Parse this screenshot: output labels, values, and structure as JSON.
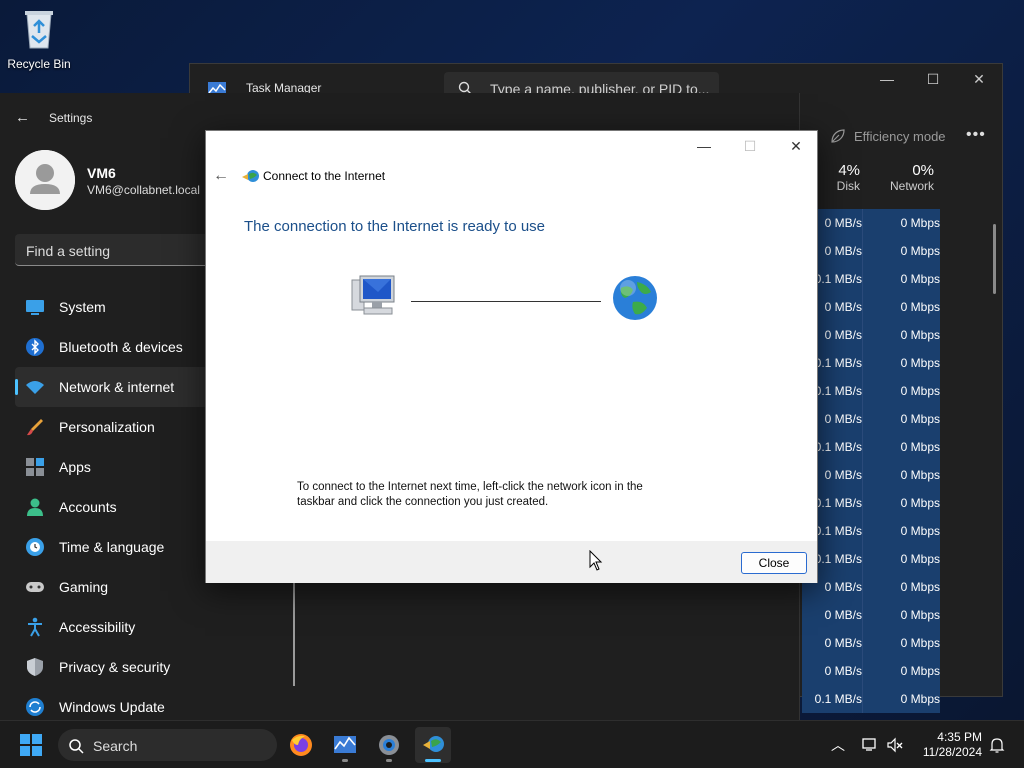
{
  "desktop": {
    "recycle_bin_label": "Recycle Bin"
  },
  "task_manager": {
    "title": "Task Manager",
    "search_placeholder": "Type a name, publisher, or PID to...",
    "efficiency_mode_label": "Efficiency mode",
    "more_label": "•••",
    "disk_pct": "4%",
    "disk_label": "Disk",
    "network_pct": "0%",
    "network_label": "Network",
    "rows": [
      {
        "disk": "0 MB/s",
        "net": "0 Mbps"
      },
      {
        "disk": "0 MB/s",
        "net": "0 Mbps"
      },
      {
        "disk": "0.1 MB/s",
        "net": "0 Mbps"
      },
      {
        "disk": "0 MB/s",
        "net": "0 Mbps"
      },
      {
        "disk": "0 MB/s",
        "net": "0 Mbps"
      },
      {
        "disk": "0.1 MB/s",
        "net": "0 Mbps"
      },
      {
        "disk": "0.1 MB/s",
        "net": "0 Mbps"
      },
      {
        "disk": "0 MB/s",
        "net": "0 Mbps"
      },
      {
        "disk": "0.1 MB/s",
        "net": "0 Mbps"
      },
      {
        "disk": "0 MB/s",
        "net": "0 Mbps"
      },
      {
        "disk": "0.1 MB/s",
        "net": "0 Mbps"
      },
      {
        "disk": "0.1 MB/s",
        "net": "0 Mbps"
      },
      {
        "disk": "0.1 MB/s",
        "net": "0 Mbps"
      },
      {
        "disk": "0 MB/s",
        "net": "0 Mbps"
      },
      {
        "disk": "0 MB/s",
        "net": "0 Mbps"
      },
      {
        "disk": "0 MB/s",
        "net": "0 Mbps"
      },
      {
        "disk": "0 MB/s",
        "net": "0 Mbps"
      },
      {
        "disk": "0.1 MB/s",
        "net": "0 Mbps"
      }
    ]
  },
  "settings": {
    "title": "Settings",
    "user_name": "VM6",
    "user_email": "VM6@collabnet.local",
    "search_placeholder": "Find a setting",
    "nav": [
      {
        "label": "System",
        "icon": "system-icon",
        "active": false
      },
      {
        "label": "Bluetooth & devices",
        "icon": "bluetooth-icon",
        "active": false
      },
      {
        "label": "Network & internet",
        "icon": "wifi-icon",
        "active": true
      },
      {
        "label": "Personalization",
        "icon": "brush-icon",
        "active": false
      },
      {
        "label": "Apps",
        "icon": "apps-icon",
        "active": false
      },
      {
        "label": "Accounts",
        "icon": "person-icon",
        "active": false
      },
      {
        "label": "Time & language",
        "icon": "clock-globe-icon",
        "active": false
      },
      {
        "label": "Gaming",
        "icon": "gamepad-icon",
        "active": false
      },
      {
        "label": "Accessibility",
        "icon": "accessibility-icon",
        "active": false
      },
      {
        "label": "Privacy & security",
        "icon": "shield-icon",
        "active": false
      },
      {
        "label": "Windows Update",
        "icon": "update-icon",
        "active": false
      }
    ]
  },
  "dialog": {
    "wizard_title": "Connect to the Internet",
    "heading": "The connection to the Internet is ready to use",
    "info_text": "To connect to the Internet next time, left-click the network icon in the taskbar and click the connection you just created.",
    "close_button": "Close"
  },
  "taskbar": {
    "search_placeholder": "Search",
    "time": "4:35 PM",
    "date": "11/28/2024"
  }
}
